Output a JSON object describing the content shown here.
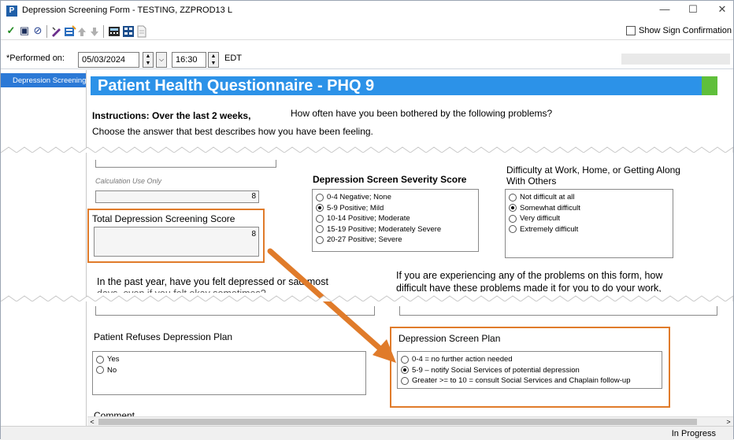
{
  "window": {
    "title": "Depression Screening Form - TESTING, ZZPROD13 L",
    "app_icon": "P",
    "minimize_icon": "—",
    "maximize_icon": "☐",
    "close_icon": "✕"
  },
  "toolbar": {
    "checkmark_icon": "✓",
    "save_icon": "▣",
    "cancel_icon": "⊘",
    "show_sign_label": "Show Sign Confirmation"
  },
  "performed": {
    "label": "*Performed on:",
    "date": "05/03/2024",
    "time": "16:30",
    "timezone": "EDT"
  },
  "sidebar": {
    "items": [
      {
        "label": "Depression Screening"
      }
    ]
  },
  "form": {
    "banner_title": "Patient Health Questionnaire - PHQ 9",
    "instructions_bold": "Instructions: Over the last 2 weeks,",
    "instructions_rest": "How often have you been bothered by the following problems?",
    "instructions_line2": "Choose the answer that best describes how you have been feeling.",
    "calc_label": "Calculation Use Only",
    "calc_value": "8",
    "total_label": "Total Depression Screening Score",
    "total_value": "8",
    "severity": {
      "title": "Depression Screen Severity Score",
      "options": [
        {
          "label": "0-4 Negative; None",
          "selected": false
        },
        {
          "label": "5-9 Positive; Mild",
          "selected": true
        },
        {
          "label": "10-14 Positive; Moderate",
          "selected": false
        },
        {
          "label": "15-19 Positive; Moderately Severe",
          "selected": false
        },
        {
          "label": "20-27 Positive; Severe",
          "selected": false
        }
      ]
    },
    "difficulty": {
      "title_line1": "Difficulty at Work, Home, or Getting Along",
      "title_line2": "With Others",
      "options": [
        {
          "label": "Not difficult at all",
          "selected": false
        },
        {
          "label": "Somewhat difficult",
          "selected": true
        },
        {
          "label": "Very difficult",
          "selected": false
        },
        {
          "label": "Extremely difficult",
          "selected": false
        }
      ]
    },
    "past_year_q": "In the past year, have you felt depressed or sad most",
    "past_year_q2": "days, even if you felt okay sometimes?",
    "problems_q": "If you are experiencing any of the problems on this form, how",
    "problems_q2": "difficult have these problems made it for you to do your work,",
    "refuses": {
      "title": "Patient Refuses Depression Plan",
      "options": [
        {
          "label": "Yes",
          "selected": false
        },
        {
          "label": "No",
          "selected": false
        }
      ]
    },
    "plan": {
      "title": "Depression Screen Plan",
      "options": [
        {
          "label": "0-4 = no further action needed",
          "selected": false
        },
        {
          "label": "5-9 – notify Social Services of potential depression",
          "selected": true
        },
        {
          "label": "Greater >= to 10 = consult Social Services and Chaplain follow-up",
          "selected": false
        }
      ]
    },
    "comment_label": "Comment"
  },
  "status": {
    "text": "In Progress"
  },
  "colors": {
    "banner": "#2c92e8",
    "banner_accent": "#5fbf3b",
    "highlight": "#e07b2a",
    "sidebar_selected": "#2b79d6"
  }
}
